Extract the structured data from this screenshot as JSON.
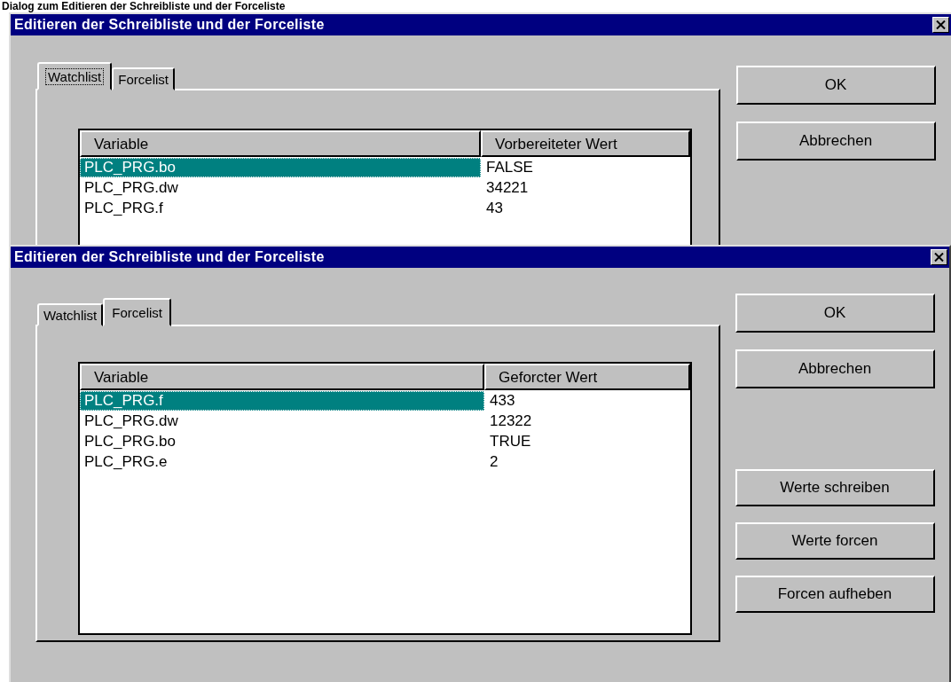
{
  "caption": "Dialog zum Editieren der Schreibliste und der Forceliste",
  "windows": [
    {
      "title": "Editieren der Schreibliste und der Forceliste",
      "tabs": [
        {
          "label": "Watchlist",
          "selected": true
        },
        {
          "label": "Forcelist",
          "selected": false
        }
      ],
      "columns": [
        "Variable",
        "Vorbereiteter Wert"
      ],
      "rows": [
        {
          "cells": [
            "PLC_PRG.bo",
            "FALSE"
          ],
          "selected": true
        },
        {
          "cells": [
            "PLC_PRG.dw",
            "34221"
          ],
          "selected": false
        },
        {
          "cells": [
            "PLC_PRG.f",
            "43"
          ],
          "selected": false
        }
      ],
      "buttons": [
        {
          "label": "OK"
        },
        {
          "label": "Abbrechen"
        }
      ]
    },
    {
      "title": "Editieren der Schreibliste und der Forceliste",
      "tabs": [
        {
          "label": "Watchlist",
          "selected": false
        },
        {
          "label": "Forcelist",
          "selected": true
        }
      ],
      "columns": [
        "Variable",
        "Geforcter Wert"
      ],
      "rows": [
        {
          "cells": [
            "PLC_PRG.f",
            "433"
          ],
          "selected": true
        },
        {
          "cells": [
            "PLC_PRG.dw",
            "12322"
          ],
          "selected": false
        },
        {
          "cells": [
            "PLC_PRG.bo",
            "TRUE"
          ],
          "selected": false
        },
        {
          "cells": [
            "PLC_PRG.e",
            "2"
          ],
          "selected": false
        }
      ],
      "buttons": [
        {
          "label": "OK"
        },
        {
          "label": "Abbrechen"
        }
      ],
      "extra_buttons": [
        {
          "label": "Werte schreiben"
        },
        {
          "label": "Werte forcen"
        },
        {
          "label": "Forcen aufheben"
        }
      ]
    }
  ]
}
